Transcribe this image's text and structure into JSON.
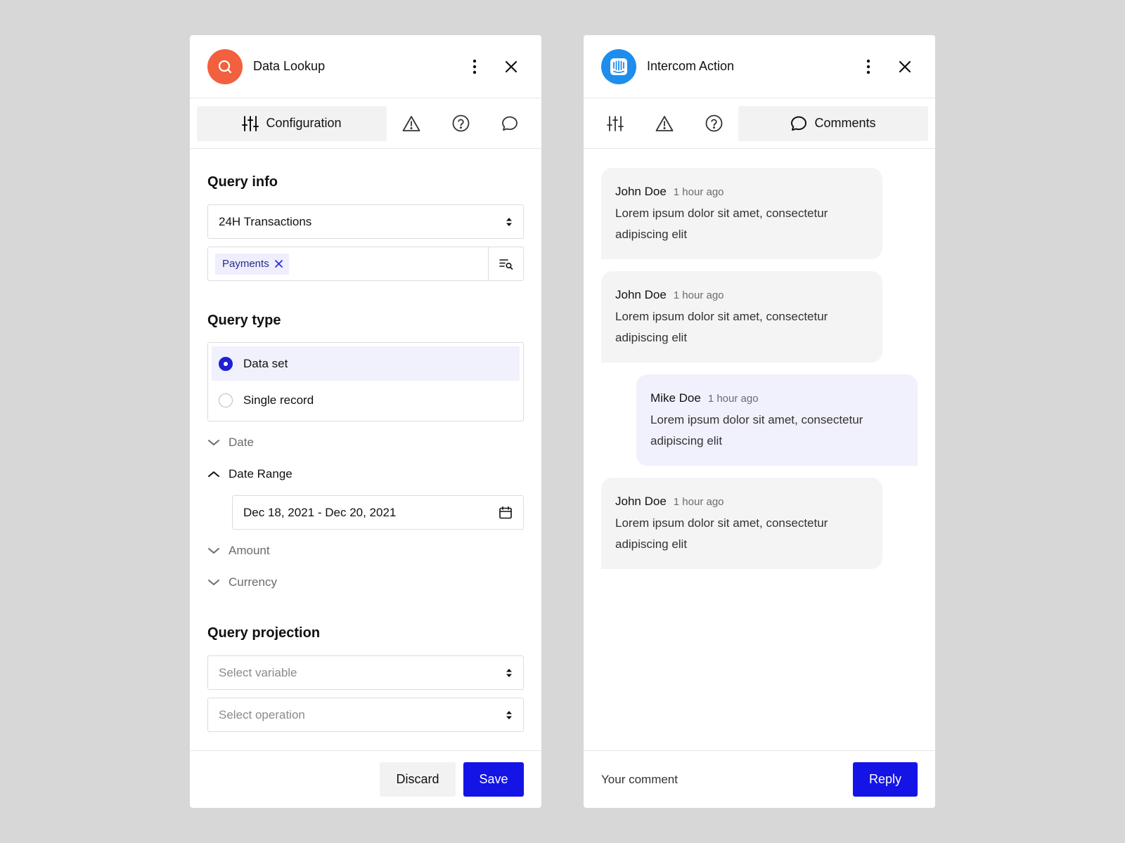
{
  "left_panel": {
    "title": "Data Lookup",
    "accent": "#f2603e",
    "tabs": {
      "active_label": "Configuration"
    },
    "query_info": {
      "title": "Query info",
      "selected_query": "24H Transactions",
      "tags": [
        "Payments"
      ]
    },
    "query_type": {
      "title": "Query type",
      "options": [
        {
          "label": "Data set",
          "selected": true
        },
        {
          "label": "Single record",
          "selected": false
        }
      ],
      "filters": {
        "date": "Date",
        "date_range": "Date Range",
        "date_range_value": "Dec 18, 2021 - Dec 20, 2021",
        "amount": "Amount",
        "currency": "Currency"
      }
    },
    "query_projection": {
      "title": "Query projection",
      "variable_placeholder": "Select variable",
      "operation_placeholder": "Select operation"
    },
    "footer": {
      "discard_label": "Discard",
      "save_label": "Save"
    }
  },
  "right_panel": {
    "title": "Intercom Action",
    "accent": "#1f8ded",
    "tabs": {
      "active_label": "Comments"
    },
    "comments": [
      {
        "author": "John Doe",
        "time": "1 hour ago",
        "body": "Lorem ipsum dolor sit amet, consectetur adipiscing elit",
        "mine": false
      },
      {
        "author": "John Doe",
        "time": "1 hour ago",
        "body": "Lorem ipsum dolor sit amet, consectetur adipiscing elit",
        "mine": false
      },
      {
        "author": "Mike Doe",
        "time": "1 hour ago",
        "body": "Lorem ipsum dolor sit amet, consectetur adipiscing elit",
        "mine": true
      },
      {
        "author": "John Doe",
        "time": "1 hour ago",
        "body": "Lorem ipsum dolor sit amet, consectetur adipiscing elit",
        "mine": false
      }
    ],
    "footer": {
      "comment_placeholder": "Your comment",
      "reply_label": "Reply"
    }
  },
  "colors": {
    "primary": "#1414e6",
    "background": "#d7d7d8"
  }
}
